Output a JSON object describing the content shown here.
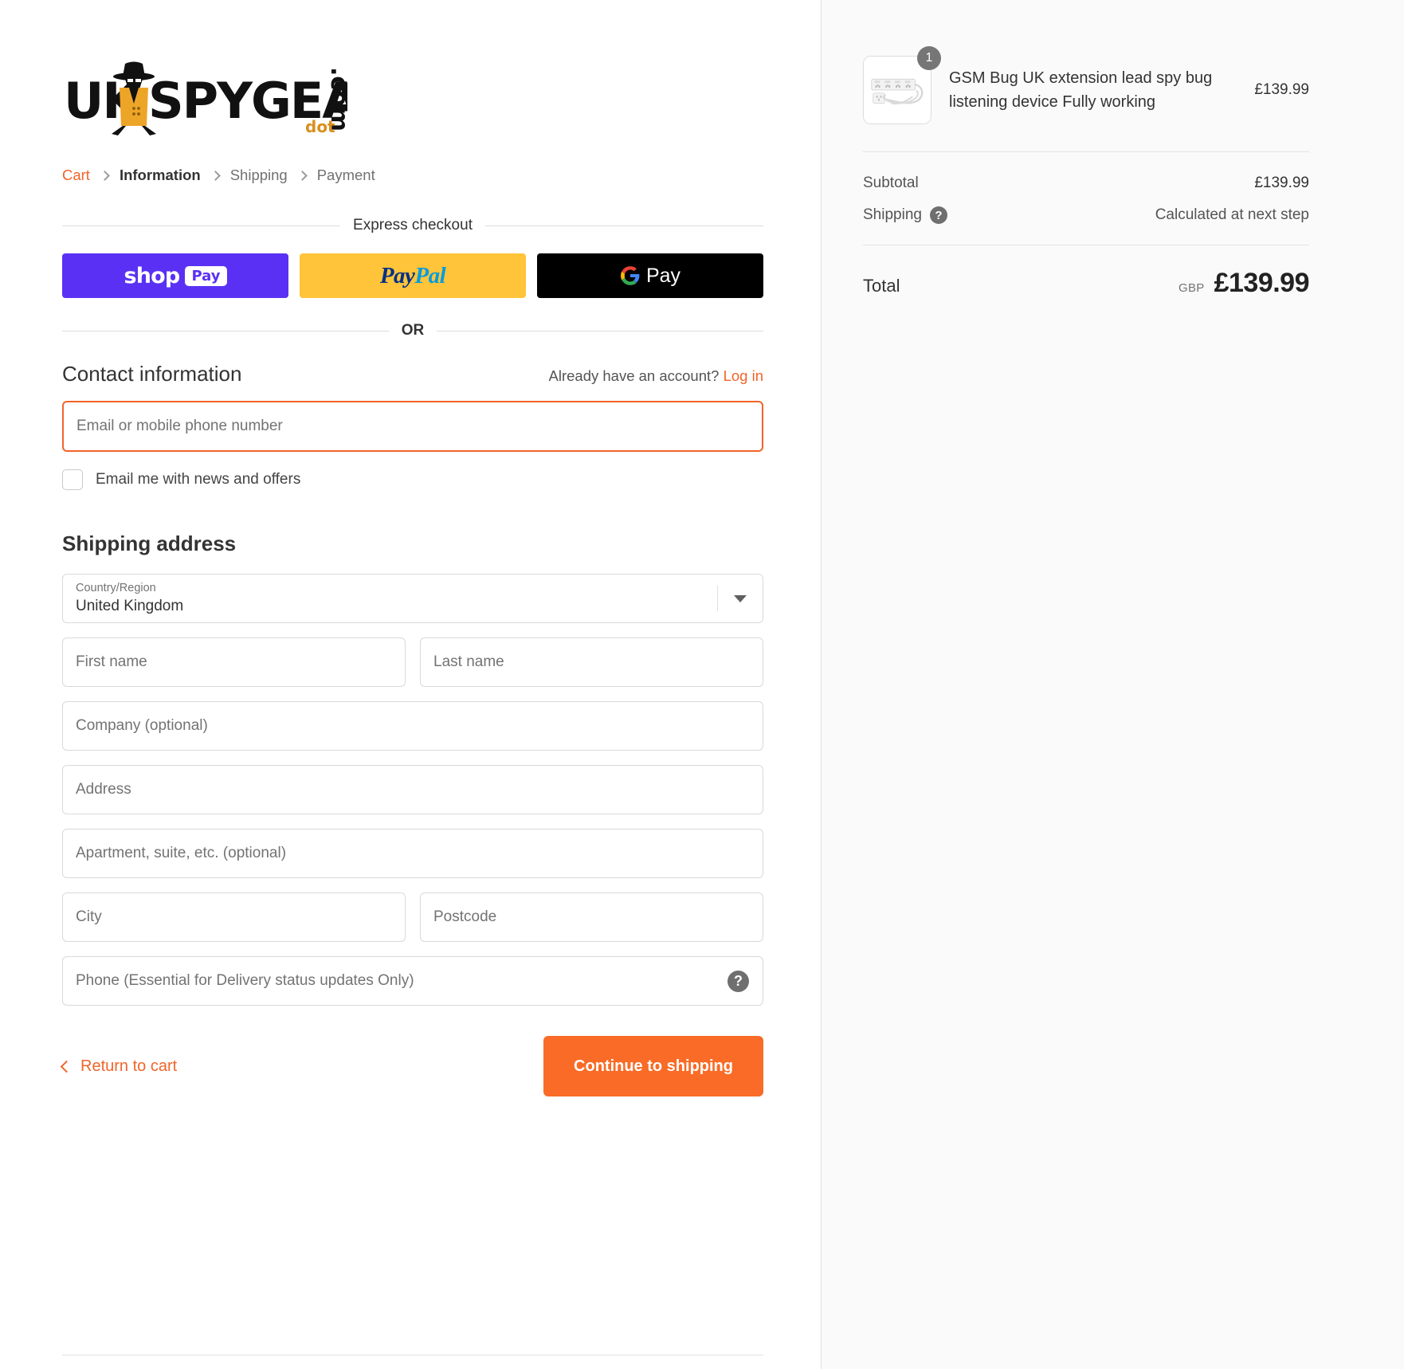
{
  "brand": {
    "logo_text_1": "UK",
    "logo_text_2": "SPYGEAR",
    "logo_text_com": ".com",
    "logo_text_dot": "dot",
    "accent_color": "#f2642a",
    "button_color": "#f96b26"
  },
  "breadcrumb": [
    {
      "label": "Cart",
      "state": "link"
    },
    {
      "label": "Information",
      "state": "current"
    },
    {
      "label": "Shipping",
      "state": "upcoming"
    },
    {
      "label": "Payment",
      "state": "upcoming"
    }
  ],
  "express": {
    "heading": "Express checkout",
    "or_label": "OR",
    "buttons": [
      {
        "name": "shop-pay",
        "word": "shop",
        "chip": "Pay",
        "bg": "#5a31f4"
      },
      {
        "name": "paypal",
        "word_1": "Pay",
        "word_2": "Pal",
        "bg": "#ffc439"
      },
      {
        "name": "google-pay",
        "word": "Pay",
        "bg": "#000000"
      }
    ]
  },
  "contact": {
    "title": "Contact information",
    "account_prompt": "Already have an account?",
    "login_label": "Log in",
    "email_placeholder": "Email or mobile phone number",
    "email_value": "",
    "newsletter_label": "Email me with news and offers",
    "newsletter_checked": false
  },
  "shipping_address": {
    "title": "Shipping address",
    "country_label": "Country/Region",
    "country_value": "United Kingdom",
    "first_name_placeholder": "First name",
    "first_name_value": "",
    "last_name_placeholder": "Last name",
    "last_name_value": "",
    "company_placeholder": "Company (optional)",
    "company_value": "",
    "address_placeholder": "Address",
    "address_value": "",
    "apartment_placeholder": "Apartment, suite, etc. (optional)",
    "apartment_value": "",
    "city_placeholder": "City",
    "city_value": "",
    "postcode_placeholder": "Postcode",
    "postcode_value": "",
    "phone_placeholder": "Phone (Essential for Delivery status updates Only)",
    "phone_value": "",
    "phone_help_icon": "question-mark-icon"
  },
  "actions": {
    "return_to_cart": "Return to cart",
    "continue_label": "Continue to shipping"
  },
  "order_summary": {
    "items": [
      {
        "title": "GSM Bug UK extension lead spy bug listening device Fully working",
        "price": "£139.99",
        "quantity": "1",
        "image_alt": "white UK 4-gang extension lead with coiled cable"
      }
    ],
    "subtotal_label": "Subtotal",
    "subtotal_value": "£139.99",
    "shipping_label": "Shipping",
    "shipping_help_icon": "question-mark-icon",
    "shipping_value": "Calculated at next step",
    "total_label": "Total",
    "total_currency": "GBP",
    "total_value": "£139.99"
  }
}
